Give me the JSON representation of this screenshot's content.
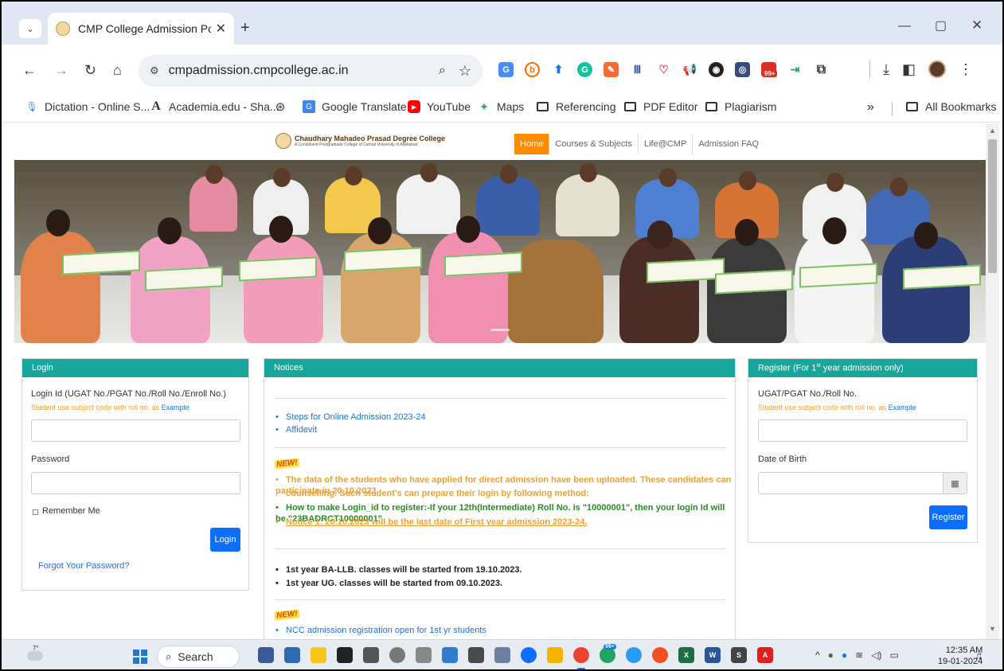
{
  "browser": {
    "tab_title": "CMP College Admission Portal",
    "tab_close": "✕",
    "new_tab": "+",
    "url": "cmpadmission.cmpcollege.ac.in",
    "window_controls": {
      "minimize": "—",
      "restore": "▢",
      "close": "✕"
    },
    "extension_badge": "99+",
    "icons": [
      "tab-search-icon",
      "back-icon",
      "forward-icon",
      "reload-icon",
      "home-icon",
      "site-info-icon",
      "zoom-icon",
      "star-icon",
      "downloads-icon",
      "side-panel-icon",
      "profile-avatar",
      "menu-icon"
    ]
  },
  "bookmarks": [
    {
      "label": "Dictation - Online S...",
      "icon": "mic-icon",
      "color": "#4285f4"
    },
    {
      "label": "Academia.edu - Sha...",
      "icon": "academia-icon",
      "color": "#222222"
    },
    {
      "label": "",
      "icon": "globe-icon",
      "color": "#333333"
    },
    {
      "label": "Google Translate",
      "icon": "translate-icon",
      "color": "#4285f4"
    },
    {
      "label": "YouTube",
      "icon": "youtube-icon",
      "color": "#ff0000"
    },
    {
      "label": "Maps",
      "icon": "maps-icon",
      "color": "#34a853"
    },
    {
      "label": "Referencing",
      "icon": "folder-icon",
      "color": "#333333"
    },
    {
      "label": "PDF Editor",
      "icon": "folder-icon",
      "color": "#333333"
    },
    {
      "label": "Plagiarism",
      "icon": "folder-icon",
      "color": "#333333"
    }
  ],
  "bookmarks_overflow": "»",
  "all_bookmarks": "All Bookmarks",
  "site": {
    "college_name": "Chaudhary Mahadeo Prasad Degree College",
    "college_subtitle": "A Constituent Postgraduate College of Central University of Allahabad",
    "nav": [
      "Home",
      "Courses & Subjects",
      "Life@CMP",
      "Admission FAQ"
    ],
    "active_nav": "Home",
    "accent_color": "#18a69c",
    "nav_active_color": "#ff8c00"
  },
  "login": {
    "header": "Login",
    "id_label": "Login Id (UGAT No./PGAT No./Roll No./Enroll No.)",
    "hint": "Student use subject code with roll no. as",
    "hint_link": "Example",
    "password_label": "Password",
    "remember_me": "Remember Me",
    "login_button": "Login",
    "forgot_password": "Forgot Your Password?"
  },
  "notices": {
    "header": "Notices",
    "group1": [
      "Steps for Online Admission 2023-24",
      "Affidevit"
    ],
    "new_label": "NEW!",
    "group2": [
      {
        "text": "The data of the students who have applied for direct admission have been uploaded. These candidates can participate in 20.10.2023",
        "style": "orange"
      },
      {
        "text": "counselling. Such student's can prepare their login by following method:",
        "style": "orange-cont"
      },
      {
        "text": "How to make Login_id to register:-If your 12th(Intermediate) Roll No. is \"10000001\", then your login Id will be \"23BADRCT10000001\"",
        "style": "green"
      },
      {
        "text": "Notice 1: 20.10.2023 will be the last date of First year admission 2023-24.",
        "style": "orange-underline"
      }
    ],
    "group3": [
      "1st year BA-LLB. classes will be started from 19.10.2023.",
      "1st year UG. classes will be started from 09.10.2023."
    ],
    "group4": [
      "NCC admission registration open for 1st yr students"
    ]
  },
  "register": {
    "header_main": "Register (For 1",
    "header_sup": "st",
    "header_end": " year admission only)",
    "id_label": "UGAT/PGAT No./Roll No.",
    "hint": "Student use subject code with roll no. as",
    "hint_link": "Example",
    "dob_label": "Date of Birth",
    "register_button": "Register"
  },
  "taskbar": {
    "temperature": "7°",
    "search_label": "Search",
    "notification_badge": "99+",
    "time": "12:35 AM",
    "date": "19-01-2024"
  }
}
